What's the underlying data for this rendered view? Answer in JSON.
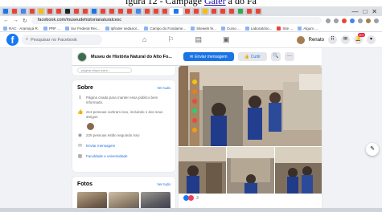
{
  "caption": {
    "prefix": "igura 12 - Campage",
    "link": "Galer",
    "suffix": "a do Fa"
  },
  "colors": {
    "fb_blue": "#1877f2",
    "button_blue": "#1b74e4",
    "link": "#216fdb",
    "page_bg": "#f0f2f5"
  },
  "browser": {
    "url": "facebook.com/museudehistorianaturalcesc",
    "window_controls": [
      "—",
      "□",
      "✕"
    ],
    "bookmarks": [
      "RAC · Aramaçá R.",
      "PRF ...",
      "Sur Federal Rec...",
      "Ipfinder sedanol...",
      "Campo do Fundame...",
      "Siteweb fe...",
      "Curso ...",
      "Laboratório...",
      "Site ...",
      "Algum ..."
    ]
  },
  "fb_nav": {
    "logo": "f",
    "search_placeholder": "Pesquisar no Facebook",
    "icons": [
      "home-icon",
      "pages-icon",
      "store-icon",
      "grid-icon"
    ],
    "user_name": "Renato",
    "notification_count": "20+"
  },
  "page_header": {
    "name": "Museu de História Natural do Alto Fo...",
    "send_message": "Enviar mensagem",
    "like": "Curtir",
    "search_glyph": "🔍",
    "more_glyph": "···"
  },
  "left": {
    "top_input_placeholder": "página clique para...",
    "about": {
      "title": "Sobre",
      "see_all": "Ver tudo",
      "rows": [
        {
          "icon": "info-icon",
          "glyph": "ℹ",
          "text": "Página criada para manter essa público bem informado.",
          "link": false
        },
        {
          "icon": "like-icon",
          "glyph": "👍",
          "text": "213 pessoas curtiram isso, incluindo 1 dos seus amigos",
          "link": false
        },
        {
          "icon": "follow-icon",
          "glyph": "◉",
          "text": "225 pessoas estão seguindo isso",
          "link": false
        },
        {
          "icon": "messenger-icon",
          "glyph": "✉",
          "text": "Enviar mensagem",
          "link": true
        },
        {
          "icon": "category-icon",
          "glyph": "▦",
          "text": "Faculdade e universidade",
          "link": true
        }
      ]
    },
    "photos": {
      "title": "Fotos",
      "see_all": "Ver tudo"
    }
  },
  "post": {
    "reaction_count": "3"
  },
  "fab": {
    "glyph": "✎"
  }
}
